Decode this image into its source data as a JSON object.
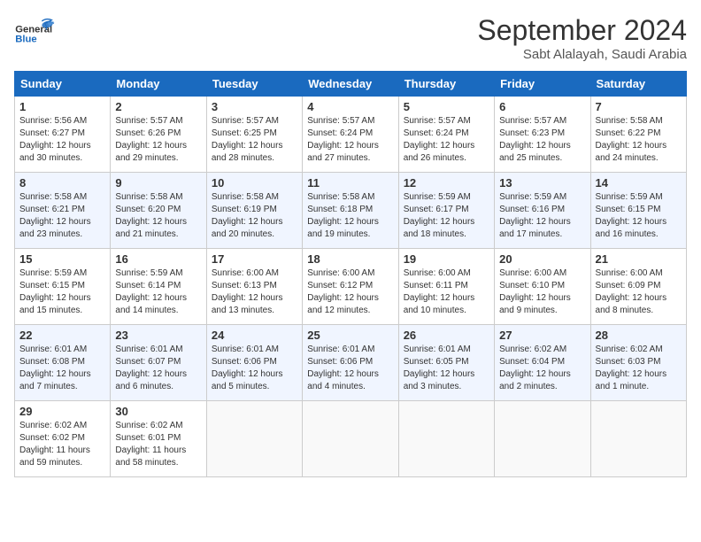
{
  "header": {
    "logo_line1": "General",
    "logo_line2": "Blue",
    "month": "September 2024",
    "location": "Sabt Alalayah, Saudi Arabia"
  },
  "days_of_week": [
    "Sunday",
    "Monday",
    "Tuesday",
    "Wednesday",
    "Thursday",
    "Friday",
    "Saturday"
  ],
  "weeks": [
    [
      {
        "day": "1",
        "info": "Sunrise: 5:56 AM\nSunset: 6:27 PM\nDaylight: 12 hours\nand 30 minutes."
      },
      {
        "day": "2",
        "info": "Sunrise: 5:57 AM\nSunset: 6:26 PM\nDaylight: 12 hours\nand 29 minutes."
      },
      {
        "day": "3",
        "info": "Sunrise: 5:57 AM\nSunset: 6:25 PM\nDaylight: 12 hours\nand 28 minutes."
      },
      {
        "day": "4",
        "info": "Sunrise: 5:57 AM\nSunset: 6:24 PM\nDaylight: 12 hours\nand 27 minutes."
      },
      {
        "day": "5",
        "info": "Sunrise: 5:57 AM\nSunset: 6:24 PM\nDaylight: 12 hours\nand 26 minutes."
      },
      {
        "day": "6",
        "info": "Sunrise: 5:57 AM\nSunset: 6:23 PM\nDaylight: 12 hours\nand 25 minutes."
      },
      {
        "day": "7",
        "info": "Sunrise: 5:58 AM\nSunset: 6:22 PM\nDaylight: 12 hours\nand 24 minutes."
      }
    ],
    [
      {
        "day": "8",
        "info": "Sunrise: 5:58 AM\nSunset: 6:21 PM\nDaylight: 12 hours\nand 23 minutes."
      },
      {
        "day": "9",
        "info": "Sunrise: 5:58 AM\nSunset: 6:20 PM\nDaylight: 12 hours\nand 21 minutes."
      },
      {
        "day": "10",
        "info": "Sunrise: 5:58 AM\nSunset: 6:19 PM\nDaylight: 12 hours\nand 20 minutes."
      },
      {
        "day": "11",
        "info": "Sunrise: 5:58 AM\nSunset: 6:18 PM\nDaylight: 12 hours\nand 19 minutes."
      },
      {
        "day": "12",
        "info": "Sunrise: 5:59 AM\nSunset: 6:17 PM\nDaylight: 12 hours\nand 18 minutes."
      },
      {
        "day": "13",
        "info": "Sunrise: 5:59 AM\nSunset: 6:16 PM\nDaylight: 12 hours\nand 17 minutes."
      },
      {
        "day": "14",
        "info": "Sunrise: 5:59 AM\nSunset: 6:15 PM\nDaylight: 12 hours\nand 16 minutes."
      }
    ],
    [
      {
        "day": "15",
        "info": "Sunrise: 5:59 AM\nSunset: 6:15 PM\nDaylight: 12 hours\nand 15 minutes."
      },
      {
        "day": "16",
        "info": "Sunrise: 5:59 AM\nSunset: 6:14 PM\nDaylight: 12 hours\nand 14 minutes."
      },
      {
        "day": "17",
        "info": "Sunrise: 6:00 AM\nSunset: 6:13 PM\nDaylight: 12 hours\nand 13 minutes."
      },
      {
        "day": "18",
        "info": "Sunrise: 6:00 AM\nSunset: 6:12 PM\nDaylight: 12 hours\nand 12 minutes."
      },
      {
        "day": "19",
        "info": "Sunrise: 6:00 AM\nSunset: 6:11 PM\nDaylight: 12 hours\nand 10 minutes."
      },
      {
        "day": "20",
        "info": "Sunrise: 6:00 AM\nSunset: 6:10 PM\nDaylight: 12 hours\nand 9 minutes."
      },
      {
        "day": "21",
        "info": "Sunrise: 6:00 AM\nSunset: 6:09 PM\nDaylight: 12 hours\nand 8 minutes."
      }
    ],
    [
      {
        "day": "22",
        "info": "Sunrise: 6:01 AM\nSunset: 6:08 PM\nDaylight: 12 hours\nand 7 minutes."
      },
      {
        "day": "23",
        "info": "Sunrise: 6:01 AM\nSunset: 6:07 PM\nDaylight: 12 hours\nand 6 minutes."
      },
      {
        "day": "24",
        "info": "Sunrise: 6:01 AM\nSunset: 6:06 PM\nDaylight: 12 hours\nand 5 minutes."
      },
      {
        "day": "25",
        "info": "Sunrise: 6:01 AM\nSunset: 6:06 PM\nDaylight: 12 hours\nand 4 minutes."
      },
      {
        "day": "26",
        "info": "Sunrise: 6:01 AM\nSunset: 6:05 PM\nDaylight: 12 hours\nand 3 minutes."
      },
      {
        "day": "27",
        "info": "Sunrise: 6:02 AM\nSunset: 6:04 PM\nDaylight: 12 hours\nand 2 minutes."
      },
      {
        "day": "28",
        "info": "Sunrise: 6:02 AM\nSunset: 6:03 PM\nDaylight: 12 hours\nand 1 minute."
      }
    ],
    [
      {
        "day": "29",
        "info": "Sunrise: 6:02 AM\nSunset: 6:02 PM\nDaylight: 11 hours\nand 59 minutes."
      },
      {
        "day": "30",
        "info": "Sunrise: 6:02 AM\nSunset: 6:01 PM\nDaylight: 11 hours\nand 58 minutes."
      },
      {
        "day": "",
        "info": ""
      },
      {
        "day": "",
        "info": ""
      },
      {
        "day": "",
        "info": ""
      },
      {
        "day": "",
        "info": ""
      },
      {
        "day": "",
        "info": ""
      }
    ]
  ]
}
